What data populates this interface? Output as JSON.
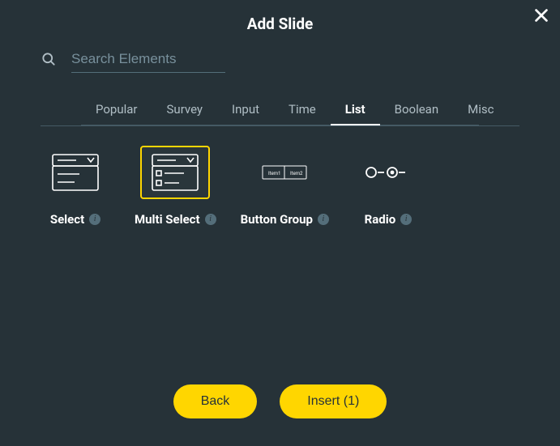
{
  "title": "Add Slide",
  "search": {
    "placeholder": "Search Elements",
    "value": ""
  },
  "tabs": {
    "items": [
      {
        "label": "Popular"
      },
      {
        "label": "Survey"
      },
      {
        "label": "Input"
      },
      {
        "label": "Time"
      },
      {
        "label": "List"
      },
      {
        "label": "Boolean"
      },
      {
        "label": "Misc"
      }
    ],
    "active_index": 4
  },
  "elements": {
    "select": {
      "label": "Select",
      "info": "i",
      "selected": false
    },
    "multi_select": {
      "label": "Multi Select",
      "info": "i",
      "selected": true
    },
    "button_group": {
      "label": "Button Group",
      "info": "i",
      "selected": false,
      "thumb_text_1": "Item1",
      "thumb_text_2": "Item2"
    },
    "radio": {
      "label": "Radio",
      "info": "i",
      "selected": false
    }
  },
  "footer": {
    "back_label": "Back",
    "insert_label": "Insert (1)"
  },
  "colors": {
    "accent": "#ffd600",
    "bg": "#263238"
  }
}
